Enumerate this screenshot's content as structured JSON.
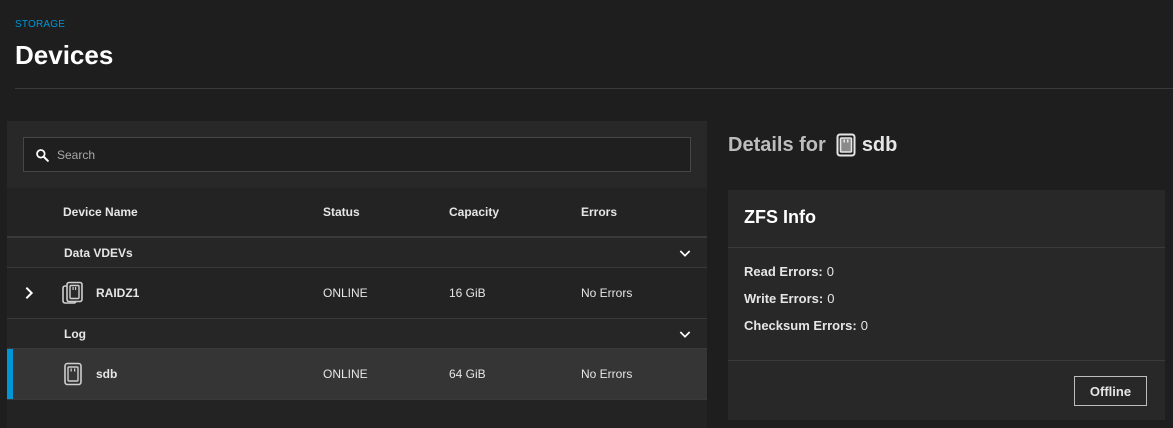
{
  "breadcrumb": "STORAGE",
  "page_title": "Devices",
  "search": {
    "placeholder": "Search"
  },
  "table": {
    "columns": [
      "Device Name",
      "Status",
      "Capacity",
      "Errors"
    ],
    "groups": [
      {
        "label": "Data VDEVs",
        "rows": [
          {
            "name": "RAIDZ1",
            "status": "ONLINE",
            "capacity": "16 GiB",
            "errors": "No Errors",
            "icon": "vdev-stack-icon",
            "expandable": true,
            "selected": false
          }
        ]
      },
      {
        "label": "Log",
        "rows": [
          {
            "name": "sdb",
            "status": "ONLINE",
            "capacity": "64 GiB",
            "errors": "No Errors",
            "icon": "disk-icon",
            "expandable": false,
            "selected": true
          }
        ]
      }
    ]
  },
  "details": {
    "title_prefix": "Details for",
    "device": "sdb",
    "card": {
      "title": "ZFS Info",
      "items": [
        {
          "label": "Read Errors:",
          "value": "0"
        },
        {
          "label": "Write Errors:",
          "value": "0"
        },
        {
          "label": "Checksum Errors:",
          "value": "0"
        }
      ],
      "action_label": "Offline"
    }
  },
  "colors": {
    "accent": "#0095d5",
    "background": "#1e1e1e",
    "panel": "#282828"
  }
}
